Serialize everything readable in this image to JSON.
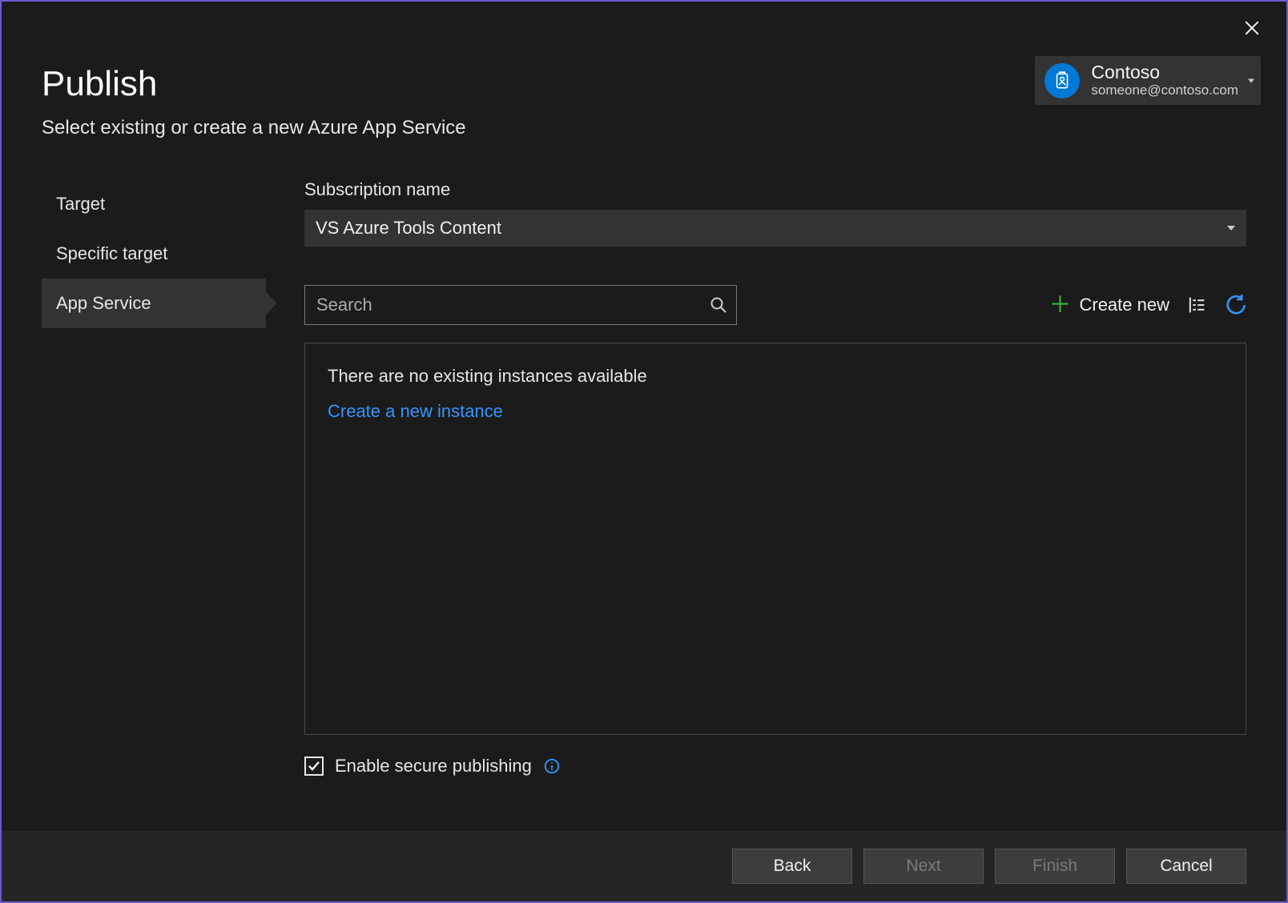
{
  "header": {
    "title": "Publish",
    "subtitle": "Select existing or create a new Azure App Service"
  },
  "account": {
    "name": "Contoso",
    "email": "someone@contoso.com"
  },
  "steps": {
    "target": "Target",
    "specific": "Specific target",
    "appservice": "App Service"
  },
  "subscription": {
    "label": "Subscription name",
    "value": "VS Azure Tools Content"
  },
  "search": {
    "placeholder": "Search"
  },
  "toolbar": {
    "create_new": "Create new"
  },
  "panel": {
    "empty_msg": "There are no existing instances available",
    "create_link": "Create a new instance"
  },
  "secure": {
    "label": "Enable secure publishing"
  },
  "buttons": {
    "back": "Back",
    "next": "Next",
    "finish": "Finish",
    "cancel": "Cancel"
  }
}
